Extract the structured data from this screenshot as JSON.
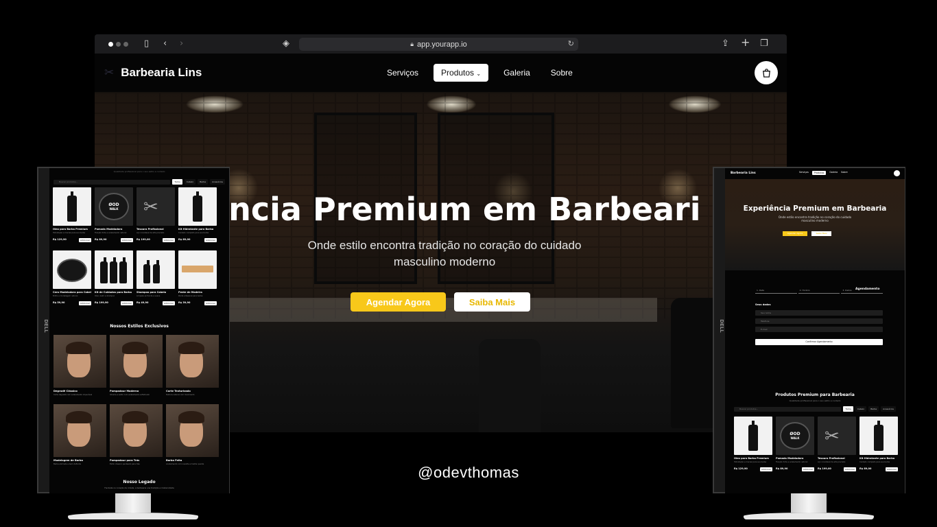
{
  "browser": {
    "url": "app.yourapp.io"
  },
  "site": {
    "brand": "Barbearia Lins",
    "nav": [
      "Serviços",
      "Produtos",
      "Galeria",
      "Sobre"
    ],
    "hero_title": "riência Premium em Barbeari",
    "hero_subtitle": "Onde estilo encontra tradição no coração do cuidado masculino moderno",
    "cta_primary": "Agendar Agora",
    "cta_secondary": "Saiba Mais"
  },
  "handle": "@odevthomas",
  "left_monitor": {
    "brand": "DELL",
    "topline": "Qualidade profissional para o seu estilo e cuidado",
    "search_placeholder": "Buscar produtos...",
    "filters": [
      "Todos",
      "Cabelo",
      "Barba",
      "Acessórios"
    ],
    "products": [
      {
        "title": "Óleo para Barba Premium",
        "desc": "Hidratação e maciez para sua barba",
        "price": "R$ 129,90",
        "add": "Adicionar"
      },
      {
        "title": "Pomada Modeladora",
        "desc": "Fixação forte e acabamento natural",
        "price": "R$ 89,90",
        "add": "Adicionar"
      },
      {
        "title": "Tesoura Profissional",
        "desc": "Aço inoxidável de alta precisão",
        "price": "R$ 199,00",
        "add": "Adicionar"
      },
      {
        "title": "Kit Hidratante para Barba",
        "desc": "Cuidado completo para sua barba",
        "price": "R$ 89,00",
        "add": "Adicionar"
      },
      {
        "title": "Cera Modeladora para Cabelo",
        "desc": "Brilho e modelagem natural",
        "price": "R$ 59,90",
        "add": "Adicionar"
      },
      {
        "title": "Kit de Cuidados para Barba",
        "desc": "Óleo, balm e shampoo",
        "price": "R$ 199,90",
        "add": "Adicionar"
      },
      {
        "title": "Shampoo para Cabelo",
        "desc": "Limpeza profunda e suave",
        "price": "R$ 49,90",
        "add": "Adicionar"
      },
      {
        "title": "Pente de Madeira",
        "desc": "Pente artesanal para barba",
        "price": "R$ 39,90",
        "add": "Adicionar"
      }
    ],
    "styles_title": "Nossos Estilos Exclusivos",
    "styles": [
      {
        "name": "Degradê Clássico",
        "desc": "Corte degradê com acabamento impecável"
      },
      {
        "name": "Pompadour Moderno",
        "desc": "Volume e estilo com acabamento sofisticado"
      },
      {
        "name": "Corte Texturizado",
        "desc": "Textura natural com movimento"
      },
      {
        "name": "Modelagem de Barba",
        "desc": "Barba alinhada e bem definida"
      },
      {
        "name": "Pompadour para Trás",
        "desc": "Estilo clássico penteado para trás"
      },
      {
        "name": "Barba Feita",
        "desc": "Acabamento com navalha e toalha quente"
      }
    ],
    "legacy_title": "Nosso Legado",
    "legacy_text": "Fundada no coração da cidade, a barbearia une tradição e modernidade"
  },
  "right_monitor": {
    "brand": "DELL",
    "site_brand": "Barbearia Lins",
    "nav": [
      "Serviços",
      "Produtos",
      "Galeria",
      "Sobre"
    ],
    "hero_title": "Experiência Premium em Barbearia",
    "hero_subtitle": "Onde estilo encontra tradição no coração do cuidado masculino moderno",
    "cta_primary": "Agendar Agora",
    "cta_secondary": "Saiba Mais",
    "form": {
      "steps": [
        "1. Data",
        "2. Horário",
        "3. Dados"
      ],
      "heading": "Agendamento",
      "section_label": "Seus dados",
      "fields": [
        "Seu nome",
        "Telefone",
        "E-mail"
      ],
      "submit": "Confirmar Agendamento"
    },
    "products_title": "Produtos Premium para Barbearia",
    "products_subtitle": "Qualidade profissional para o seu estilo e cuidado",
    "search_placeholder": "Buscar produtos...",
    "filters": [
      "Todos",
      "Cabelo",
      "Barba",
      "Acessórios"
    ]
  },
  "colors": {
    "accent": "#f8c81a",
    "background": "#000000"
  }
}
